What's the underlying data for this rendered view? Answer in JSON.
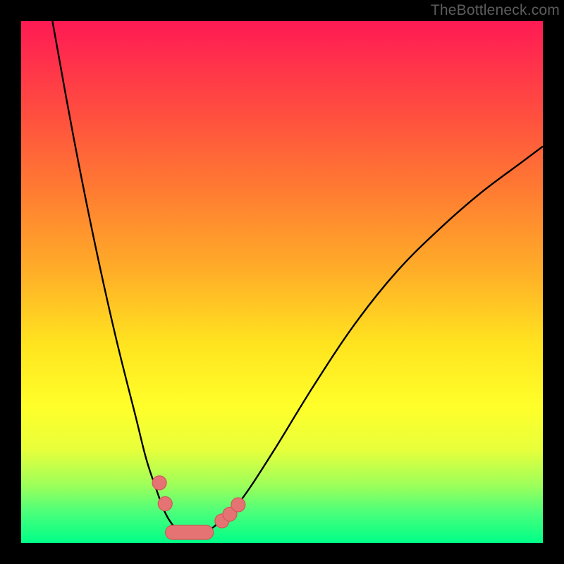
{
  "watermark": "TheBottleneck.com",
  "colors": {
    "background": "#000000",
    "curve": "#000000",
    "marker_fill": "#e57373",
    "marker_stroke": "#d05858",
    "gradient_top": "#ff1a54",
    "gradient_bottom": "#00ff88"
  },
  "chart_data": {
    "type": "line",
    "title": "",
    "xlabel": "",
    "ylabel": "",
    "xlim": [
      0,
      100
    ],
    "ylim": [
      0,
      100
    ],
    "series": [
      {
        "name": "curve",
        "x": [
          6,
          10,
          14,
          18,
          22,
          24,
          26,
          27.5,
          29,
          30.5,
          32,
          34,
          36,
          38,
          42,
          48,
          56,
          64,
          72,
          80,
          88,
          96,
          100
        ],
        "y": [
          100,
          78,
          58,
          40,
          24,
          16,
          10,
          6,
          3.5,
          2.2,
          2,
          2,
          2.5,
          4,
          8,
          17,
          30,
          42,
          52,
          60,
          67,
          73,
          76
        ]
      }
    ],
    "markers": {
      "left_arm": [
        {
          "x": 26.5,
          "y": 11.5
        },
        {
          "x": 27.6,
          "y": 7.5
        }
      ],
      "right_arm": [
        {
          "x": 38.5,
          "y": 4.2
        },
        {
          "x": 40.0,
          "y": 5.5
        },
        {
          "x": 41.6,
          "y": 7.3
        }
      ],
      "bottom_pill": {
        "x0": 29.0,
        "x1": 35.5,
        "y": 2.0
      }
    }
  }
}
